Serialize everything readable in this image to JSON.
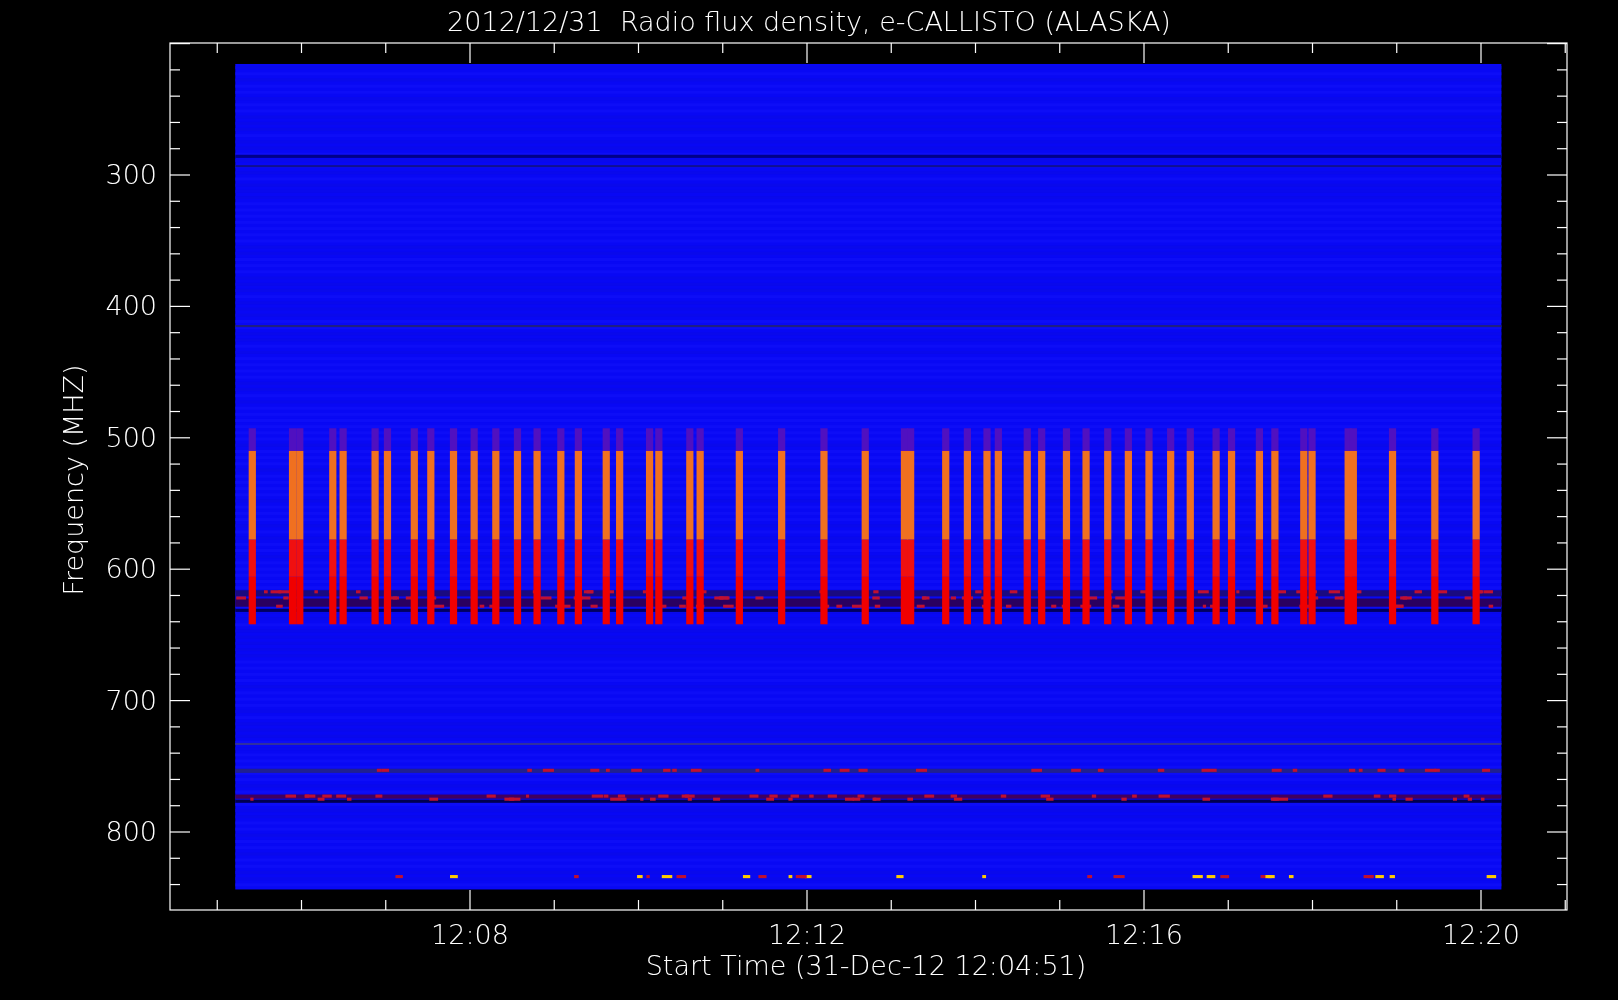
{
  "title": "2012/12/31  Radio flux density, e-CALLISTO (ALASKA)",
  "plot": {
    "ylabel": "Frequency (MHZ)",
    "xlabel": "Start Time (31-Dec-12 12:04:51)",
    "yticks": [
      "300",
      "400",
      "500",
      "600",
      "700",
      "800"
    ],
    "xticks": [
      "12:08",
      "12:12",
      "12:16",
      "12:20"
    ]
  }
}
